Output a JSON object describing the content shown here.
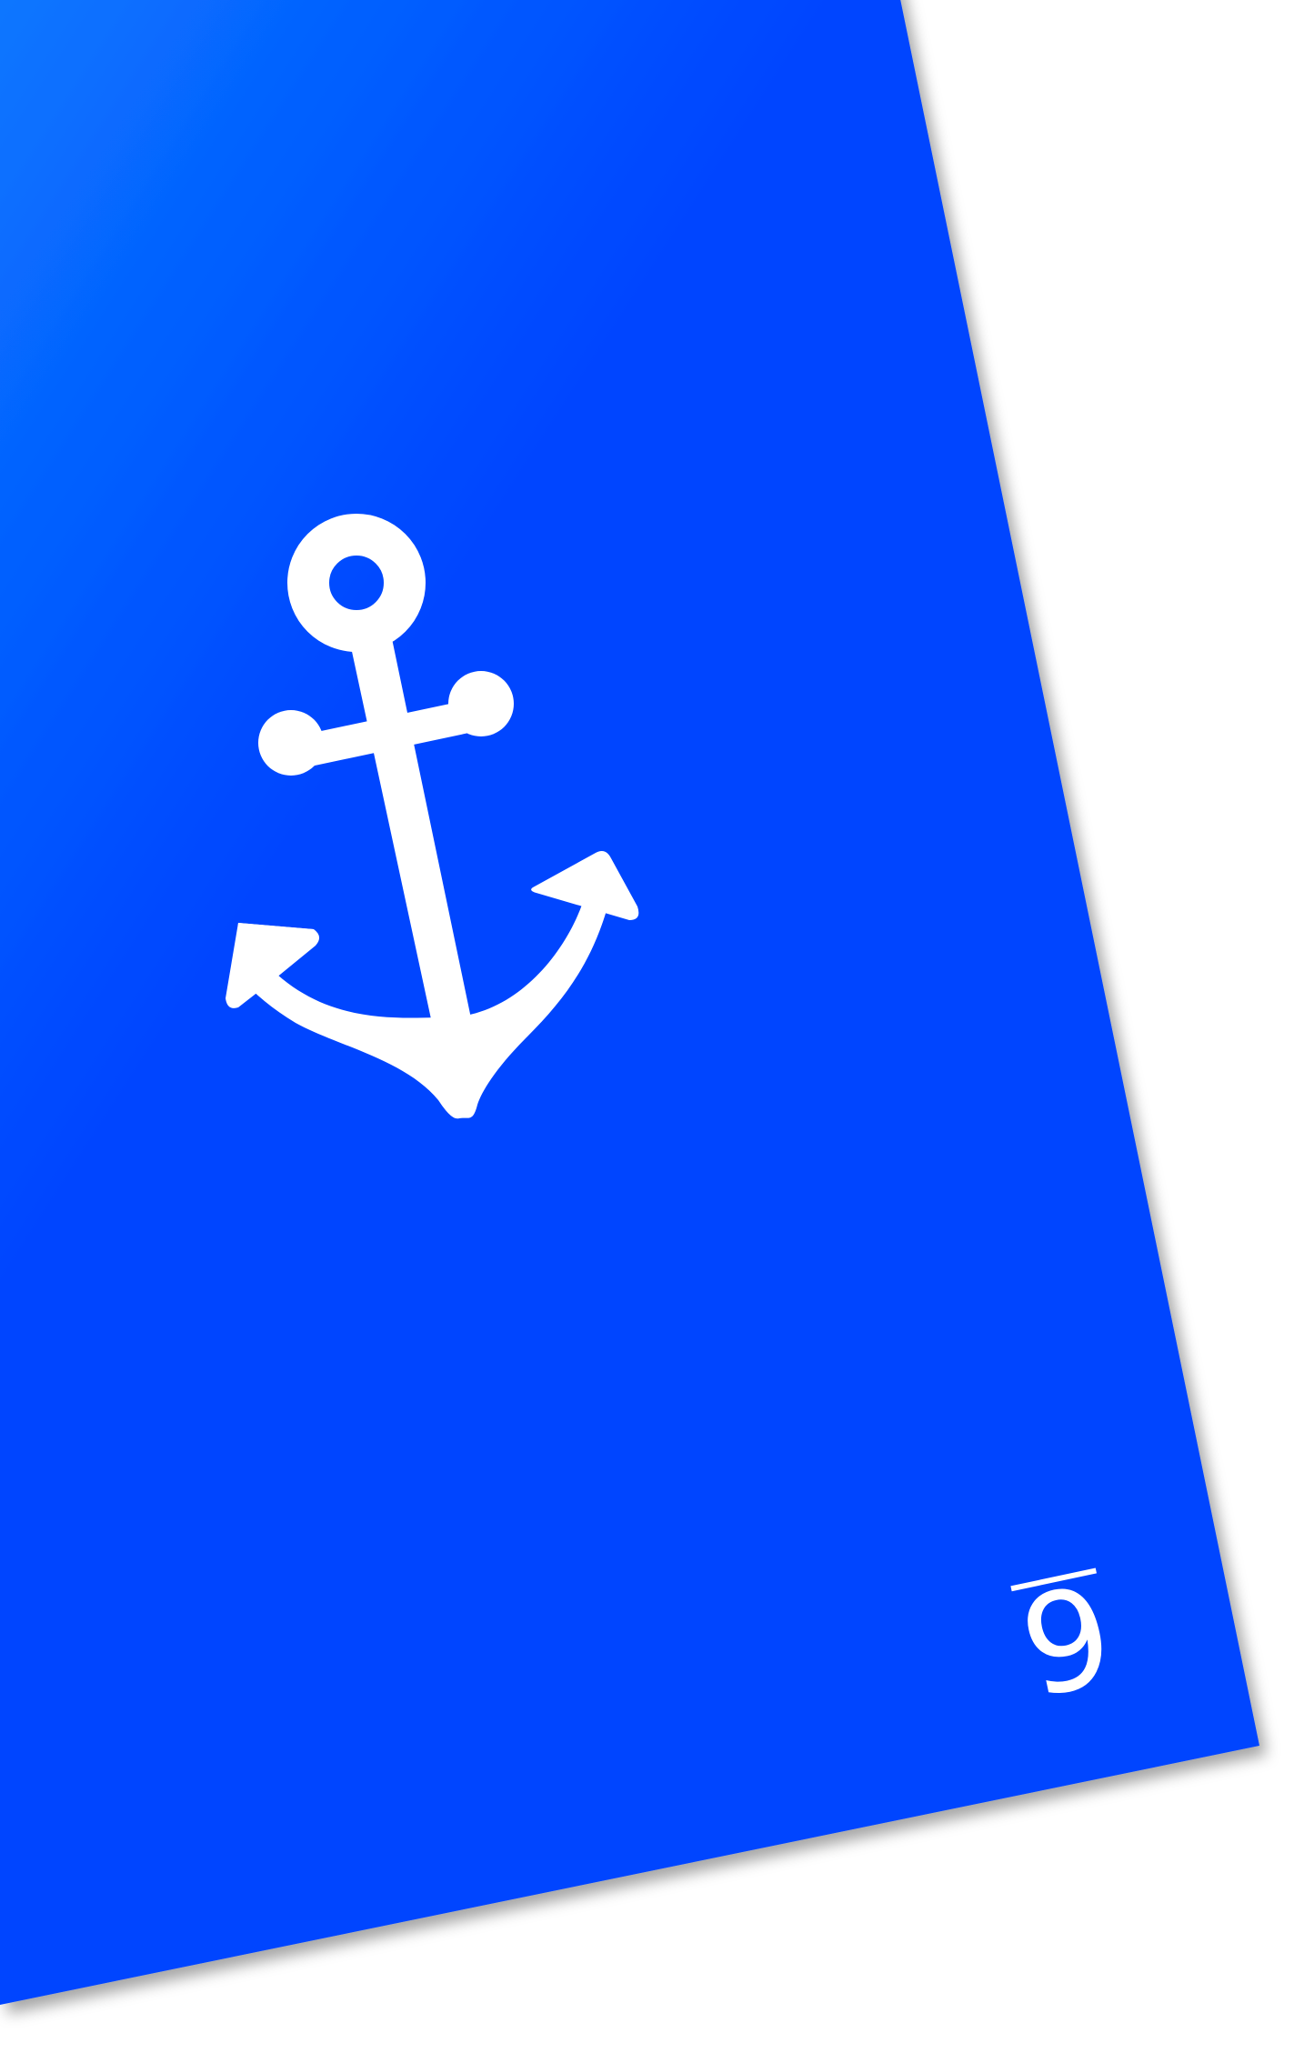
{
  "card": {
    "corner_value": "6",
    "icon": "anchor-icon",
    "colors": {
      "gradient_start": "#0a7bff",
      "gradient_end": "#0044ff",
      "icon": "#ffffff",
      "background": "#ffffff"
    }
  }
}
